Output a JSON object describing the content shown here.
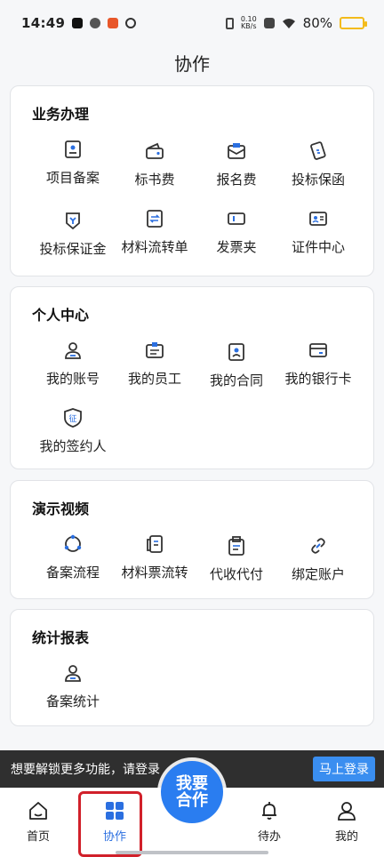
{
  "status_bar": {
    "time": "14:49",
    "network_speed_value": "0.10",
    "network_speed_unit": "KB/s",
    "battery": "80%"
  },
  "header": {
    "title": "协作"
  },
  "sections": [
    {
      "title": "业务办理",
      "items": [
        {
          "label": "项目备案",
          "icon": "project-record-icon"
        },
        {
          "label": "标书费",
          "icon": "wallet-icon"
        },
        {
          "label": "报名费",
          "icon": "envelope-icon"
        },
        {
          "label": "投标保函",
          "icon": "guarantee-icon"
        },
        {
          "label": "投标保证金",
          "icon": "deposit-icon"
        },
        {
          "label": "材料流转单",
          "icon": "transfer-doc-icon"
        },
        {
          "label": "发票夹",
          "icon": "ticket-icon"
        },
        {
          "label": "证件中心",
          "icon": "id-card-icon"
        }
      ]
    },
    {
      "title": "个人中心",
      "items": [
        {
          "label": "我的账号",
          "icon": "user-icon"
        },
        {
          "label": "我的员工",
          "icon": "badge-icon"
        },
        {
          "label": "我的合同",
          "icon": "contract-icon"
        },
        {
          "label": "我的银行卡",
          "icon": "bank-card-icon"
        },
        {
          "label": "我的签约人",
          "icon": "signer-shield-icon"
        }
      ]
    },
    {
      "title": "演示视频",
      "items": [
        {
          "label": "备案流程",
          "icon": "cycle-icon"
        },
        {
          "label": "材料票流转",
          "icon": "document-flow-icon"
        },
        {
          "label": "代收代付",
          "icon": "clipboard-icon"
        },
        {
          "label": "绑定账户",
          "icon": "link-icon"
        }
      ]
    },
    {
      "title": "统计报表",
      "items": [
        {
          "label": "备案统计",
          "icon": "user-icon"
        }
      ]
    }
  ],
  "shield_glyph": "征",
  "login_banner": {
    "text": "想要解锁更多功能，请登录",
    "button": "马上登录"
  },
  "center_button": {
    "line1": "我要",
    "line2": "合作"
  },
  "tabs": [
    {
      "label": "首页"
    },
    {
      "label": "协作"
    },
    {
      "label": "待办"
    },
    {
      "label": "我的"
    }
  ],
  "colors": {
    "accent": "#2b6fe0",
    "highlight": "#d1202a",
    "banner_bg": "#2f2f2f"
  }
}
